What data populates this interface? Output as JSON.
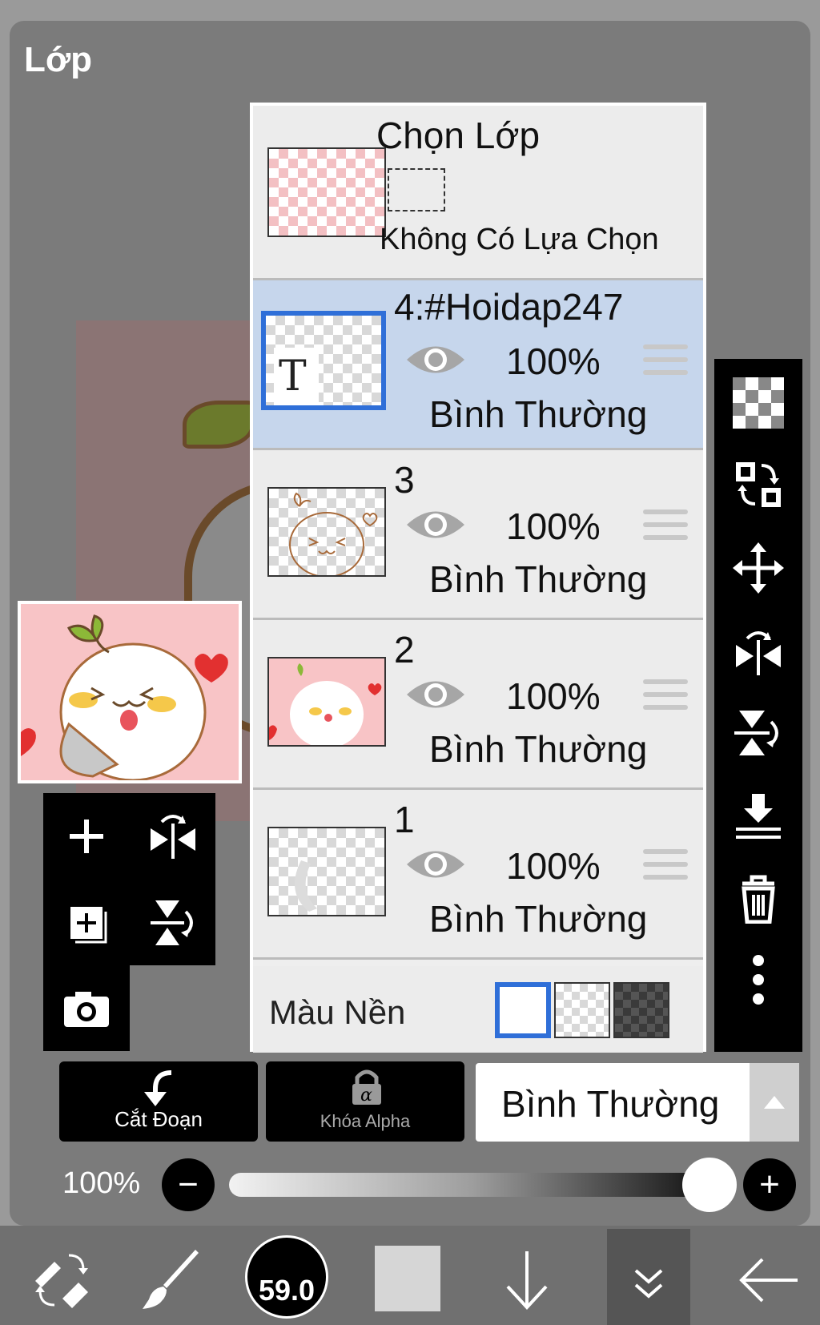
{
  "panel": {
    "title": "Lớp"
  },
  "selection": {
    "title": "Chọn Lớp",
    "status": "Không Có Lựa Chọn"
  },
  "layers": [
    {
      "name": "4:#Hoidap247",
      "opacity": "100%",
      "blend": "Bình Thường",
      "active": true,
      "thumb_text": "T"
    },
    {
      "name": "3",
      "opacity": "100%",
      "blend": "Bình Thường",
      "active": false
    },
    {
      "name": "2",
      "opacity": "100%",
      "blend": "Bình Thường",
      "active": false
    },
    {
      "name": "1",
      "opacity": "100%",
      "blend": "Bình Thường",
      "active": false
    }
  ],
  "background": {
    "label": "Màu Nền",
    "options": [
      "white",
      "transparent",
      "dark-checker"
    ],
    "selected": "white"
  },
  "controls": {
    "cut_label": "Cắt Đoạn",
    "alpha_label": "Khóa Alpha",
    "blend_value": "Bình Thường",
    "opacity_label": "100%",
    "minus": "−",
    "plus": "+",
    "opacity": 1.0
  },
  "toolbar": {
    "brush_size": "59.0",
    "current_color": "#d6d6d6"
  },
  "colors": {
    "accent": "#2f6fd8",
    "active_layer_bg": "#c6d6ec",
    "panel": "#7b7b7b"
  }
}
